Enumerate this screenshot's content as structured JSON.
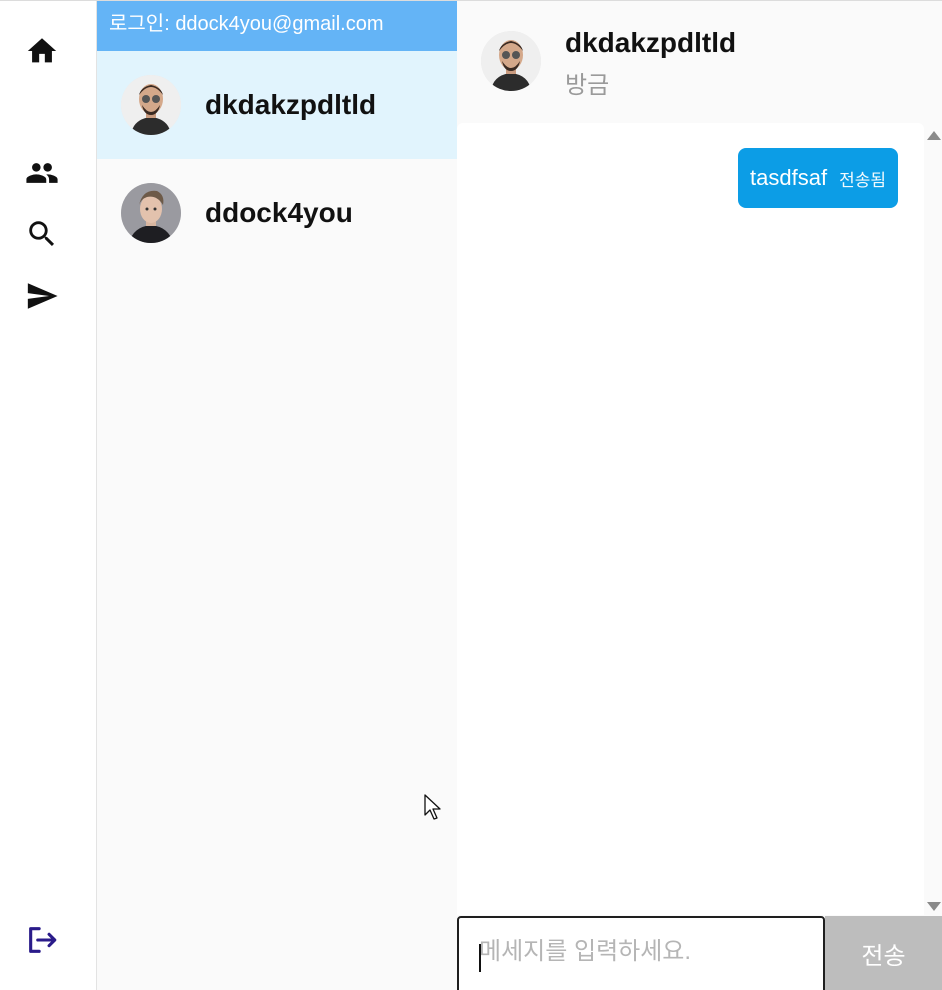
{
  "nav": {
    "icons": [
      "home-icon",
      "people-icon",
      "search-icon",
      "send-icon",
      "logout-icon"
    ],
    "logout_color": "#2a1b8a"
  },
  "login_bar": {
    "text": "로그인: ddock4you@gmail.com",
    "color": "#64b4f6"
  },
  "rooms": [
    {
      "name": "dkdakzpdltld",
      "active": true
    },
    {
      "name": "ddock4you",
      "active": false
    }
  ],
  "chat_header": {
    "name": "dkdakzpdltld",
    "time": "방금"
  },
  "messages": [
    {
      "text": "tasdfsaf",
      "status": "전송됨",
      "color": "#0c9de6"
    }
  ],
  "composer": {
    "placeholder": "메세지를 입력하세요.",
    "value": "",
    "send_label": "전송"
  }
}
